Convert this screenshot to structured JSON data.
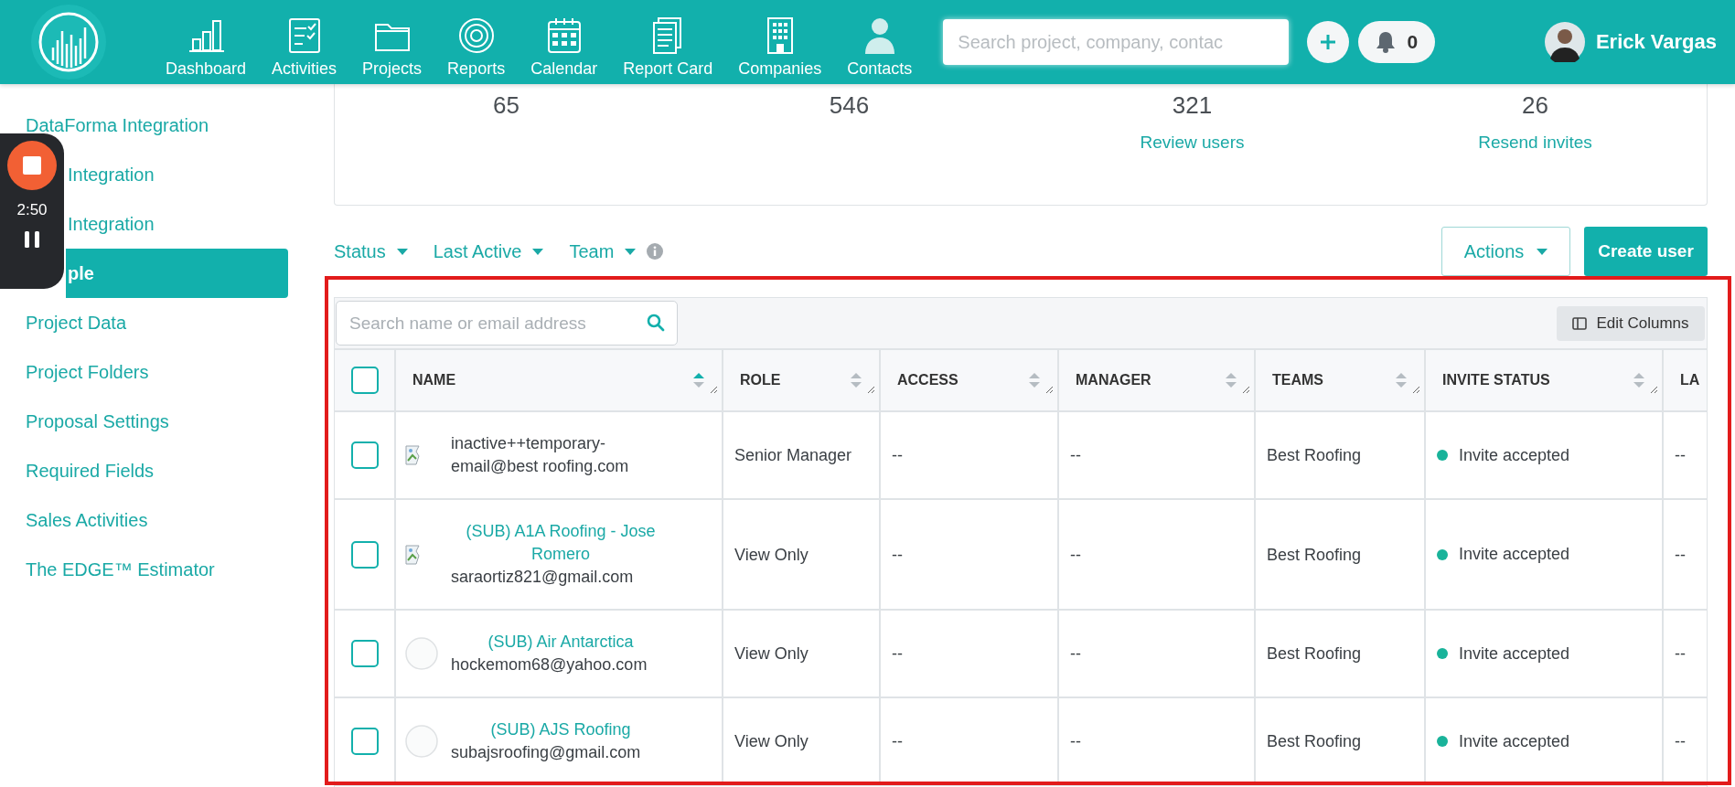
{
  "topbar": {
    "nav": [
      {
        "label": "Dashboard"
      },
      {
        "label": "Activities"
      },
      {
        "label": "Projects"
      },
      {
        "label": "Reports"
      },
      {
        "label": "Calendar"
      },
      {
        "label": "Report Card"
      },
      {
        "label": "Companies"
      },
      {
        "label": "Contacts"
      }
    ],
    "search": {
      "placeholder": "Search project, company, contac"
    },
    "notifications": {
      "count": "0"
    },
    "user": {
      "name": "Erick Vargas"
    }
  },
  "sidebar": {
    "items": [
      {
        "label": "DataForma Integration",
        "selected": false,
        "clipped": false
      },
      {
        "label": "Integration",
        "selected": false,
        "clipped": true
      },
      {
        "label": "Integration",
        "selected": false,
        "clipped": true
      },
      {
        "label": "ple",
        "selected": true,
        "clipped": true
      },
      {
        "label": "Project Data",
        "selected": false,
        "clipped": false
      },
      {
        "label": "Project Folders",
        "selected": false,
        "clipped": false
      },
      {
        "label": "Proposal Settings",
        "selected": false,
        "clipped": false
      },
      {
        "label": "Required Fields",
        "selected": false,
        "clipped": false
      },
      {
        "label": "Sales Activities",
        "selected": false,
        "clipped": false
      },
      {
        "label": "The EDGE™ Estimator",
        "selected": false,
        "clipped": false
      }
    ]
  },
  "recorder": {
    "time": "2:50"
  },
  "stats": [
    {
      "value": "65"
    },
    {
      "value": "546"
    },
    {
      "value": "321",
      "link": "Review users"
    },
    {
      "value": "26",
      "link": "Resend invites"
    }
  ],
  "filters": [
    {
      "label": "Status",
      "info": false
    },
    {
      "label": "Last Active",
      "info": false
    },
    {
      "label": "Team",
      "info": true
    }
  ],
  "actions": {
    "menu": "Actions",
    "create": "Create user"
  },
  "table": {
    "search": {
      "placeholder": "Search name or email address"
    },
    "edit_columns": "Edit Columns",
    "select_all": {
      "checked": false
    },
    "columns": [
      {
        "label": "NAME",
        "sorted": true
      },
      {
        "label": "ROLE",
        "sorted": false
      },
      {
        "label": "ACCESS",
        "sorted": false
      },
      {
        "label": "MANAGER",
        "sorted": false
      },
      {
        "label": "TEAMS",
        "sorted": false
      },
      {
        "label": "INVITE STATUS",
        "sorted": false
      },
      {
        "label": "LA"
      }
    ],
    "rows": [
      {
        "checked": false,
        "avatar_broken": true,
        "email": "inactive++temporary-email@best roofing.com",
        "role": "Senior Manager",
        "access": "--",
        "manager": "--",
        "teams": "Best Roofing",
        "invite_status": "Invite accepted",
        "column_8": "--"
      },
      {
        "checked": false,
        "avatar_broken": true,
        "name": "(SUB) A1A Roofing - Jose Romero",
        "email": "saraortiz821@gmail.com",
        "role": "View Only",
        "access": "--",
        "manager": "--",
        "teams": "Best Roofing",
        "invite_status": "Invite accepted",
        "column_8": "--"
      },
      {
        "checked": false,
        "avatar_broken": false,
        "name": "(SUB) Air Antarctica",
        "email": "hockemom68@yahoo.com",
        "role": "View Only",
        "access": "--",
        "manager": "--",
        "teams": "Best Roofing",
        "invite_status": "Invite accepted",
        "column_8": "--"
      },
      {
        "checked": false,
        "avatar_broken": false,
        "name": "(SUB) AJS Roofing",
        "email": "subajsroofing@gmail.com",
        "role": "View Only",
        "access": "--",
        "manager": "--",
        "teams": "Best Roofing",
        "invite_status": "Invite accepted",
        "column_8": "--"
      }
    ]
  }
}
